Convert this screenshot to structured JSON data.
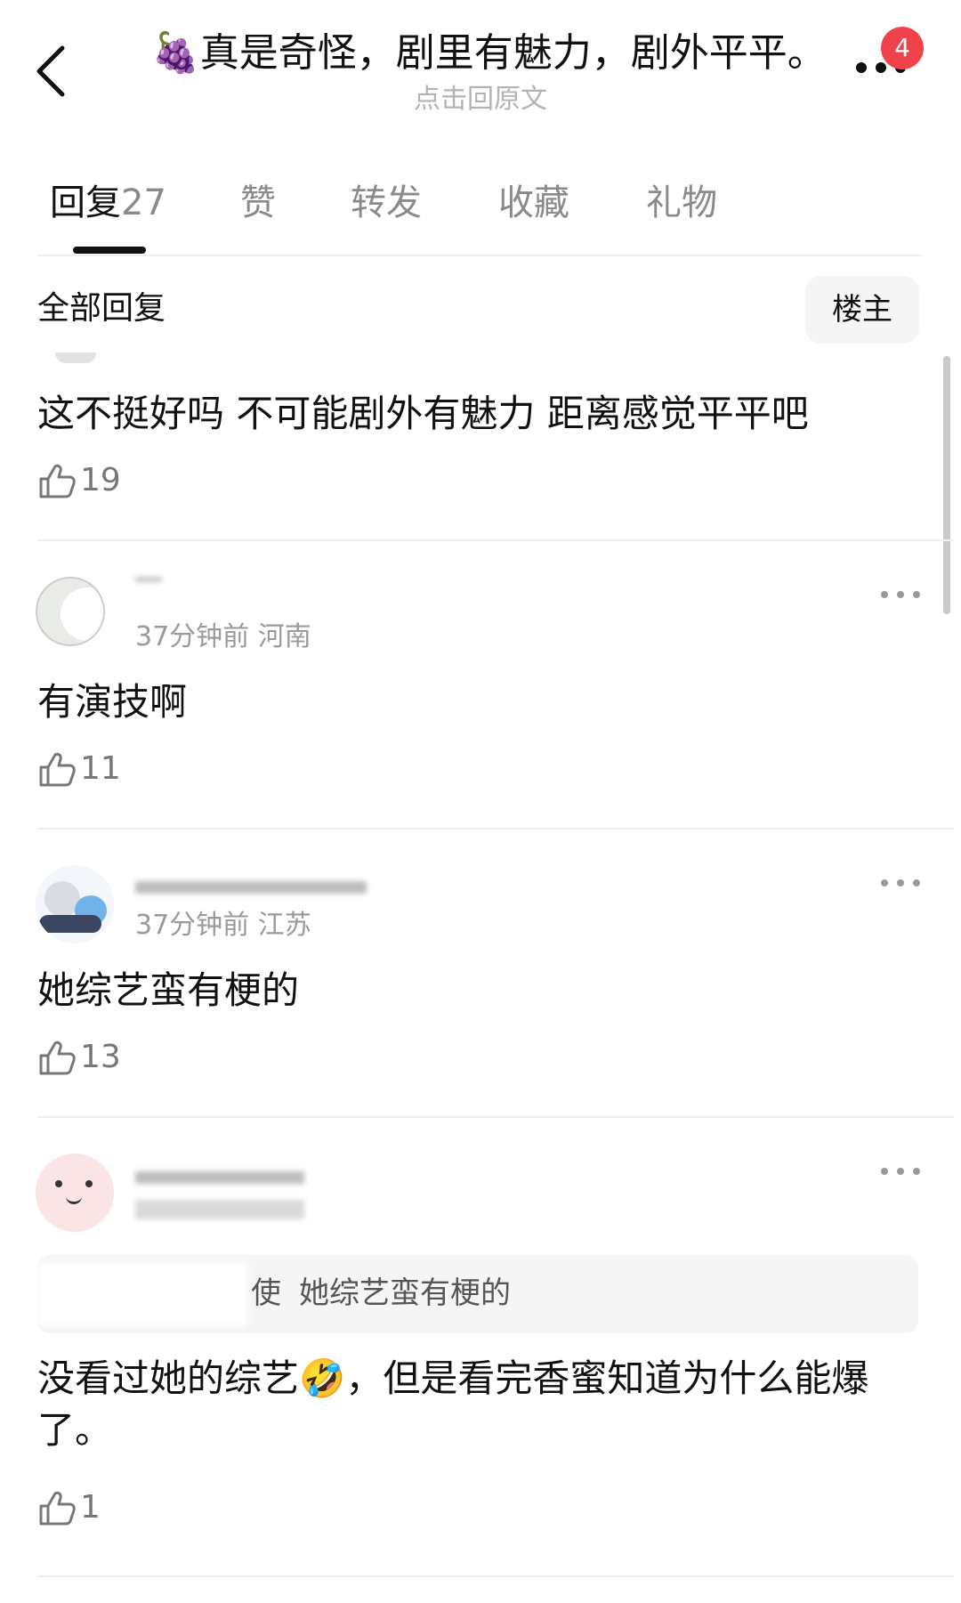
{
  "header": {
    "title_emoji": "🍇",
    "title": "真是奇怪，剧里有魅力，剧外平平。",
    "subtitle": "点击回原文",
    "notification_count": "4"
  },
  "tabs": [
    {
      "label": "回复",
      "count": "27"
    },
    {
      "label": "赞"
    },
    {
      "label": "转发"
    },
    {
      "label": "收藏"
    },
    {
      "label": "礼物"
    }
  ],
  "filter": {
    "all_replies": "全部回复",
    "op_only": "楼主"
  },
  "comments": [
    {
      "content": "这不挺好吗 不可能剧外有魅力 距离感觉平平吧",
      "likes": "19"
    },
    {
      "meta": "37分钟前 河南",
      "content": "有演技啊",
      "likes": "11"
    },
    {
      "meta": "37分钟前 江苏",
      "content": "她综艺蛮有梗的",
      "likes": "13"
    },
    {
      "quote_prefix": "使",
      "quote": "她综艺蛮有梗的",
      "content_part1": "没看过她的综艺",
      "content_emoji": "🤣",
      "content_part2": "，但是看完香蜜知道为什么能爆了。",
      "likes": "1"
    }
  ],
  "colors": {
    "badge": "#f0424a",
    "text_primary": "#111111",
    "text_secondary": "#9a9a9a"
  }
}
